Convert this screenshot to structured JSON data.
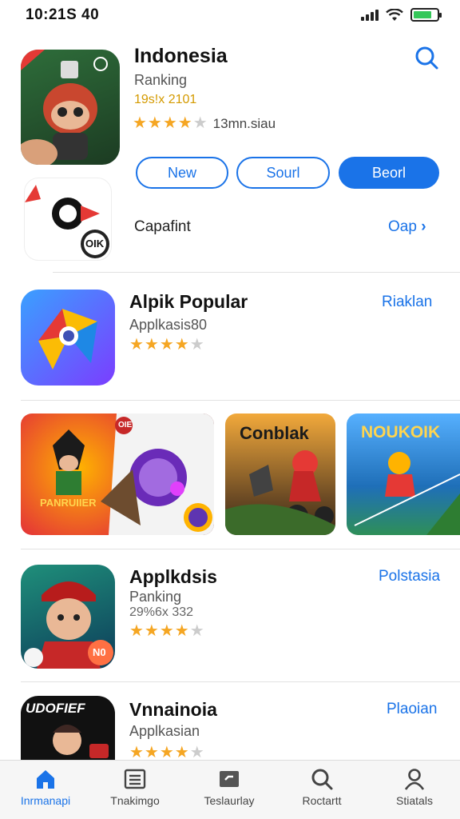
{
  "status": {
    "time": "10:21S 40"
  },
  "colors": {
    "accent": "#1a73e8",
    "star": "#f5a623"
  },
  "featured": {
    "title": "Indonesia",
    "subtitle": "Ranking",
    "meta": "19s!x 2101",
    "rating_count": "13mn.siau",
    "rating": 4.5,
    "filters": [
      "New",
      "Sourl",
      "Beorl"
    ],
    "active_filter": "Beorl"
  },
  "capafint": {
    "label": "Capafint",
    "action": "Oap"
  },
  "apps": [
    {
      "title": "Alpik Popular",
      "subtitle": "Applkasis80",
      "meta": "",
      "rating": 3.5,
      "action": "Riaklan"
    },
    {
      "title": "Applkdsis",
      "subtitle": "Panking",
      "meta": "29%6x 332",
      "rating": 3.5,
      "action": "Polstasia"
    },
    {
      "title": "Vnnainoia",
      "subtitle": "Applkasian",
      "meta": "",
      "rating": 3.5,
      "action": "Plaoian"
    }
  ],
  "banners": [
    {
      "label": "PANRUIIER",
      "badge": "OIE"
    },
    {
      "label": "Conblak"
    },
    {
      "label": "NOUKOIK"
    }
  ],
  "icon_texts": {
    "capafint_badge": "OIK",
    "app3_badge": "UDOFIEF",
    "app2_badge": "N0"
  },
  "tabs": [
    {
      "label": "Inrmanapi",
      "icon": "home-icon",
      "active": true
    },
    {
      "label": "Tnakimgo",
      "icon": "list-icon",
      "active": false
    },
    {
      "label": "Teslaurlay",
      "icon": "card-icon",
      "active": false
    },
    {
      "label": "Roctartt",
      "icon": "search-icon",
      "active": false
    },
    {
      "label": "Stiatals",
      "icon": "person-icon",
      "active": false
    }
  ]
}
